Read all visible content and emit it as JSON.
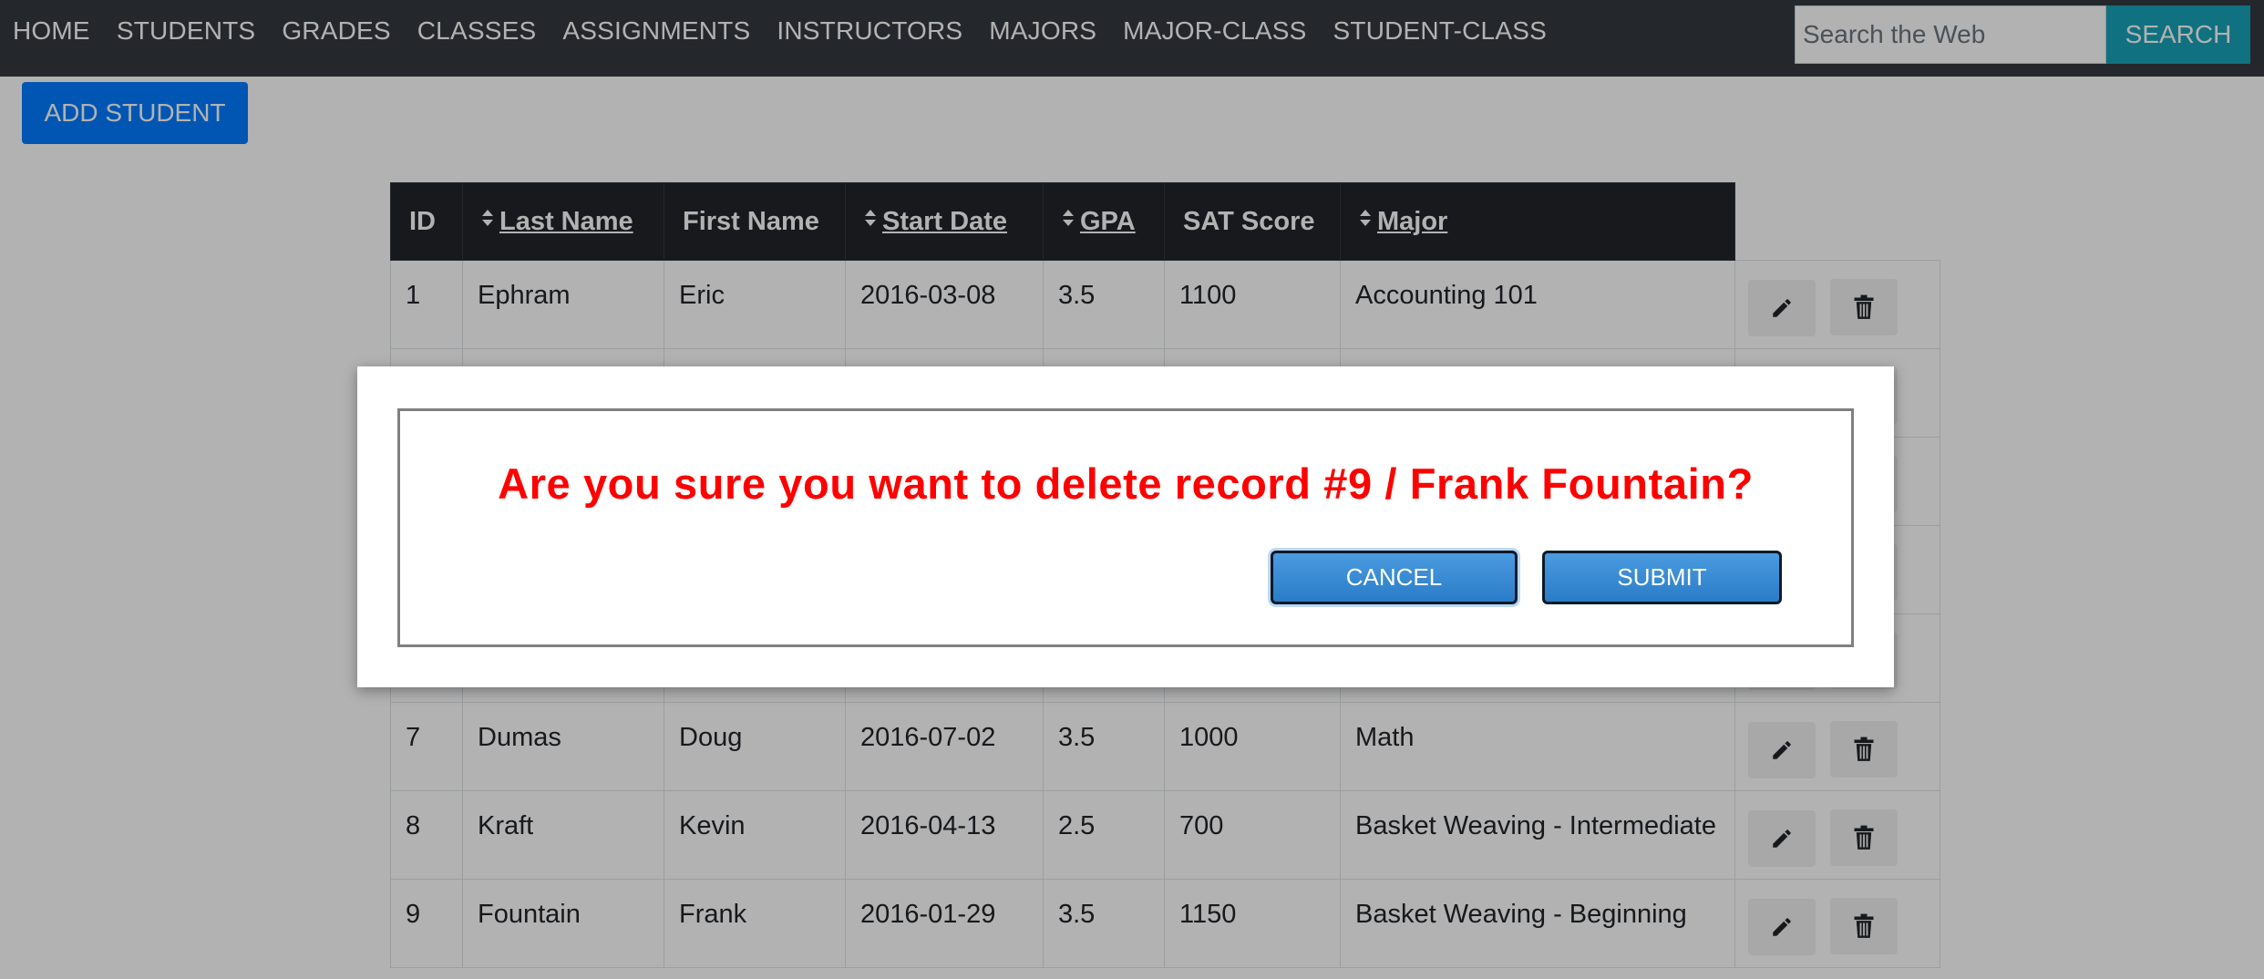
{
  "nav": {
    "links": [
      "HOME",
      "STUDENTS",
      "GRADES",
      "CLASSES",
      "ASSIGNMENTS",
      "INSTRUCTORS",
      "MAJORS",
      "MAJOR-CLASS",
      "STUDENT-CLASS"
    ],
    "search_placeholder": "Search the Web",
    "search_button": "SEARCH"
  },
  "page": {
    "add_button": "ADD STUDENT"
  },
  "table": {
    "headers": {
      "id": "ID",
      "last_name": "Last Name",
      "first_name": "First Name",
      "start_date": "Start Date",
      "gpa": "GPA",
      "sat_score": "SAT Score",
      "major": "Major"
    },
    "sort_icon": "sort-icon",
    "rows": [
      {
        "id": "1",
        "last": "Ephram",
        "first": "Eric",
        "start": "2016-03-08",
        "gpa": "3.5",
        "sat": "1100",
        "major": "Accounting 101"
      },
      {
        "id": "",
        "last": "",
        "first": "",
        "start": "",
        "gpa": "",
        "sat": "",
        "major": ""
      },
      {
        "id": "",
        "last": "",
        "first": "",
        "start": "",
        "gpa": "",
        "sat": "",
        "major": ""
      },
      {
        "id": "",
        "last": "",
        "first": "",
        "start": "",
        "gpa": "",
        "sat": "",
        "major": ""
      },
      {
        "id": "",
        "last": "",
        "first": "",
        "start": "",
        "gpa": "",
        "sat": "",
        "major": ""
      },
      {
        "id": "7",
        "last": "Dumas",
        "first": "Doug",
        "start": "2016-07-02",
        "gpa": "3.5",
        "sat": "1000",
        "major": "Math"
      },
      {
        "id": "8",
        "last": "Kraft",
        "first": "Kevin",
        "start": "2016-04-13",
        "gpa": "2.5",
        "sat": "700",
        "major": "Basket Weaving - Intermediate"
      },
      {
        "id": "9",
        "last": "Fountain",
        "first": "Frank",
        "start": "2016-01-29",
        "gpa": "3.5",
        "sat": "1150",
        "major": "Basket Weaving - Beginning"
      }
    ],
    "row_actions": [
      "pencil-icon",
      "trash-icon"
    ]
  },
  "modal": {
    "message": "Are you sure you want to delete record #9 / Frank Fountain?",
    "cancel_label": "CANCEL",
    "submit_label": "SUBMIT"
  },
  "colors": {
    "navbar": "#343a40",
    "primary": "#007bff",
    "info": "#17a2b8",
    "danger_text": "#ff0000",
    "table_head": "#212529"
  }
}
